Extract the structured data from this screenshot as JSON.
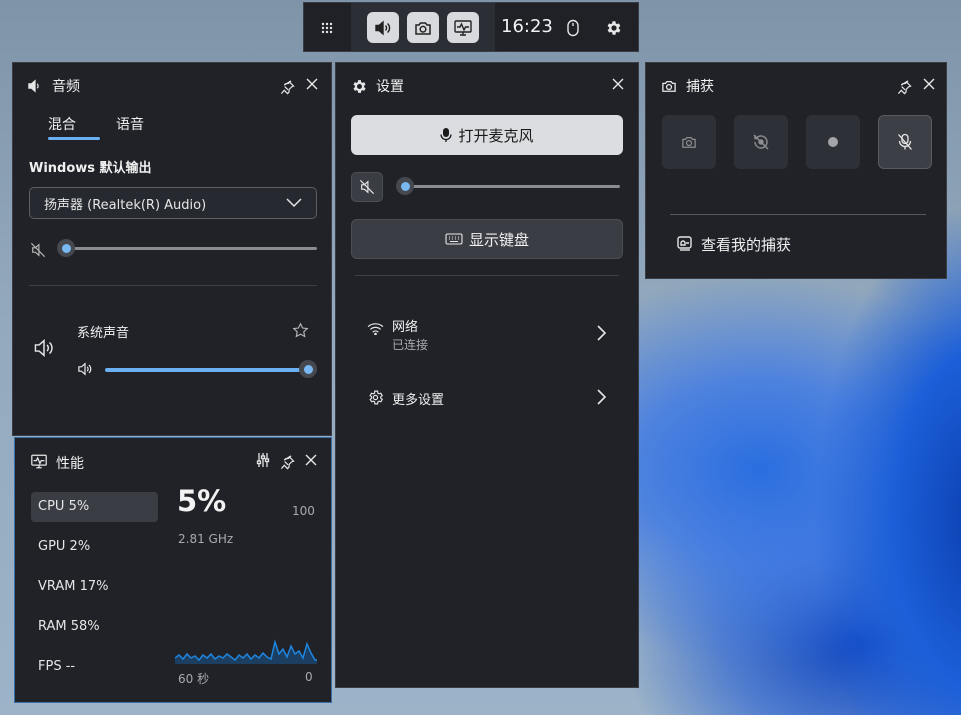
{
  "topbar": {
    "time": "16:23",
    "icons": [
      "grid-icon",
      "speaker-icon",
      "camera-icon",
      "monitor-icon",
      "mouse-icon",
      "gear-icon"
    ]
  },
  "audio": {
    "title": "音频",
    "tabs": [
      {
        "label": "混合",
        "selected": true
      },
      {
        "label": "语音",
        "selected": false
      }
    ],
    "output_label": "Windows 默认输出",
    "device": "扬声器 (Realtek(R) Audio)",
    "master_volume": 0,
    "app_name": "系统声音",
    "app_volume": 100
  },
  "settings": {
    "title": "设置",
    "mic_button": "打开麦克风",
    "mic_volume": 0,
    "keyboard_button": "显示键盘",
    "network_label": "网络",
    "network_status": "已连接",
    "more_settings": "更多设置"
  },
  "capture": {
    "title": "捕获",
    "view_captures": "查看我的捕获"
  },
  "performance": {
    "title": "性能",
    "items": [
      {
        "label": "CPU   5%",
        "selected": true
      },
      {
        "label": "GPU   2%",
        "selected": false
      },
      {
        "label": "VRAM   17%",
        "selected": false
      },
      {
        "label": "RAM   58%",
        "selected": false
      },
      {
        "label": "FPS --",
        "selected": false
      }
    ],
    "big_value": "5%",
    "frequency": "2.81 GHz",
    "max_label": "100",
    "time_left": "60 秒",
    "time_right": "0",
    "graph_color": "#1f86e0"
  },
  "colors": {
    "accent": "#6ab0f3",
    "panel": "#202227"
  }
}
